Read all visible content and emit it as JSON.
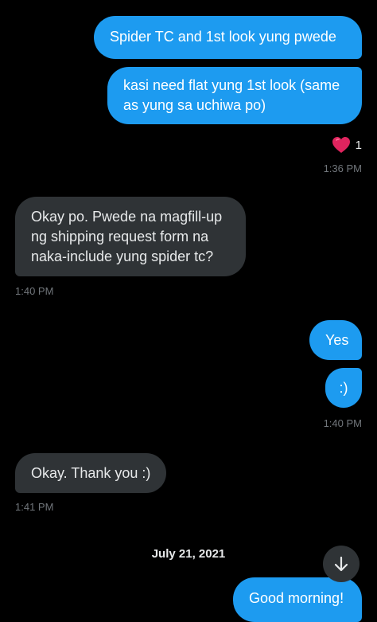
{
  "messages": [
    {
      "side": "sent",
      "lines": [
        "Spider TC and 1st look yung pwede"
      ]
    },
    {
      "side": "sent",
      "lines": [
        "kasi need flat yung 1st look (same",
        "as yung sa uchiwa po)"
      ],
      "reaction": {
        "icon": "heart-icon",
        "count": "1"
      },
      "time": "1:36 PM"
    },
    {
      "side": "recv",
      "lines": [
        "Okay po. Pwede na magfill-up",
        "ng shipping request form na",
        "naka-include yung spider tc?"
      ],
      "time": "1:40 PM"
    },
    {
      "side": "sent",
      "lines": [
        "Yes"
      ]
    },
    {
      "side": "sent",
      "lines": [
        ":)"
      ],
      "time": "1:40 PM"
    },
    {
      "side": "recv",
      "lines": [
        "Okay. Thank you :)"
      ],
      "time": "1:41 PM"
    },
    {
      "side": "sent",
      "lines": [
        "Good morning!"
      ]
    }
  ],
  "date_divider": "July 21, 2021",
  "scroll_button": {
    "icon": "arrow-down-icon"
  },
  "colors": {
    "background": "#000000",
    "sent_bubble": "#1d9bf0",
    "received_bubble": "#2f3336",
    "timestamp": "#71767b",
    "heart": "#f91880"
  }
}
